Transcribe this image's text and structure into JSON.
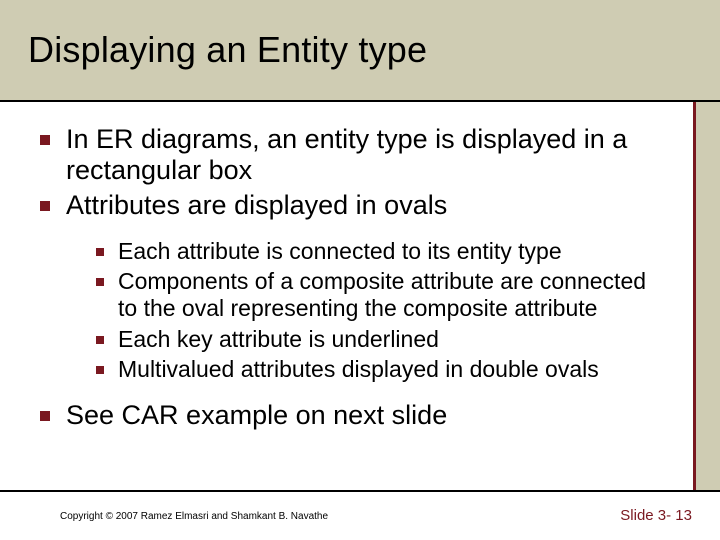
{
  "title": "Displaying an Entity type",
  "bullets_top": [
    "In ER diagrams, an entity type is displayed in a rectangular box",
    "Attributes are displayed in ovals"
  ],
  "sub_bullets": [
    "Each attribute is connected to its entity type",
    "Components of a composite attribute are connected to the oval representing the composite attribute",
    "Each key attribute is underlined",
    "Multivalued attributes displayed in double ovals"
  ],
  "bullets_bottom": [
    "See CAR example on next slide"
  ],
  "copyright": "Copyright © 2007 Ramez Elmasri and Shamkant B. Navathe",
  "slide_number": "Slide 3- 13"
}
